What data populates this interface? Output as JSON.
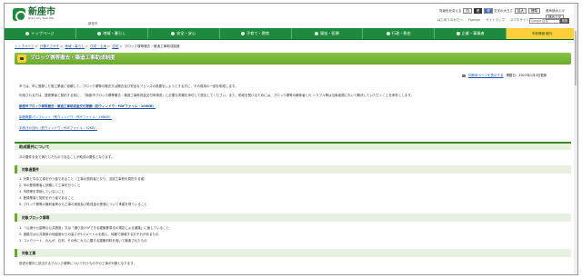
{
  "header": {
    "logo_title": "新座市",
    "logo_sub": "Niiza City Web Site",
    "kana": "新座市",
    "util_text_color_label": "背景色を変える",
    "util_color_white": "白",
    "util_color_black": "黒",
    "util_color_blue": "青",
    "util_font_label": "文字の大きさ",
    "util_font_enlarge": "拡大",
    "util_font_default": "標準",
    "util_voice_label": "音声読み上げ",
    "util_voice_btn": "読み上げ",
    "links": [
      "はじめてのかたへ",
      "Foreign",
      "サイトマップ",
      "スマホサイト"
    ],
    "search_placeholder": "Google 提供",
    "search_button": "検索"
  },
  "nav": {
    "items": [
      "トップページ",
      "地域・暮らし",
      "安全・安心",
      "子育て・教育",
      "福祉・医療",
      "行政・税金",
      "企業・事業者",
      "市政情報 観光"
    ]
  },
  "breadcrumb": [
    "トップページ",
    "分類でさがす",
    "地域・暮らし",
    "住宅・土地",
    "住宅",
    "ブロック塀等撤去・築造工事助成制度"
  ],
  "page_title": "ブロック塀等撤去・築造工事助成制度",
  "print_link": "印刷用ページを表示する",
  "updated": "掲載日：2023年1月4日更新",
  "intro_1": "市では、市に登録した施工業者に依頼して、ブロック塀等の撤去又は撤去及び安全なフェンスの設置をしようとする方に、その費用の一部を助成します。",
  "intro_2": "利用される方は、登録業者と契約する前に、「新座市ブロック塀等撤去・築造工事助成金交付申請書」に必要な書類を添付して提出してください。また、助成を受けるためには、ブロック塀等の解体者との トラブル等は当事者間において解決していただくことを条件とします。",
  "doc_links": [
    "新座市ブロック塀等撤去・築造工事助成金交付要綱（別ウィンドウ・PDFファイル・100KB）",
    "制度概要パンフレット（別ウィンドウ・PDFファイル・168KB）",
    "手続きの流れ（別ウィンドウ・PDFファイル・52KB）"
  ],
  "section_title": "助成要件について",
  "section_intro": "次の要件を全て満たしたものであることが助成の要件となります。",
  "target_person_head": "対象者要件",
  "target_person_items": [
    "1. 対象となる工事を行う者であること（工事の契約者となり、当該工事費を負担する者）",
    "2. 市の登録業者に依頼して工事を行うこと",
    "3. 市税等を滞納していないこと",
    "4. 登録業者と契約を行う者であること",
    "5. ブロック塀等の権利者等から工事の実施及び助成金の受領について承諾を得ていること"
  ],
  "target_wall_head": "対象ブロック塀等",
  "target_wall_items": [
    "1. 「公道や公園等の公共施設」又は「通り抜けができる建築基準法の規定による道路」に面していること",
    "2. 道路又は公共施設の地盤面からの高さが1.2メートルを超え、地震で倒壊するおそれがあるもの",
    "3. コンクリート、れんが、石材、その他これらに類する建築材料を用いて築造されたもの"
  ],
  "target_work_head": "対象工事",
  "target_work_text": "前述の要件に該当するブロック塀等について行うもの下の工事が対象となります。"
}
